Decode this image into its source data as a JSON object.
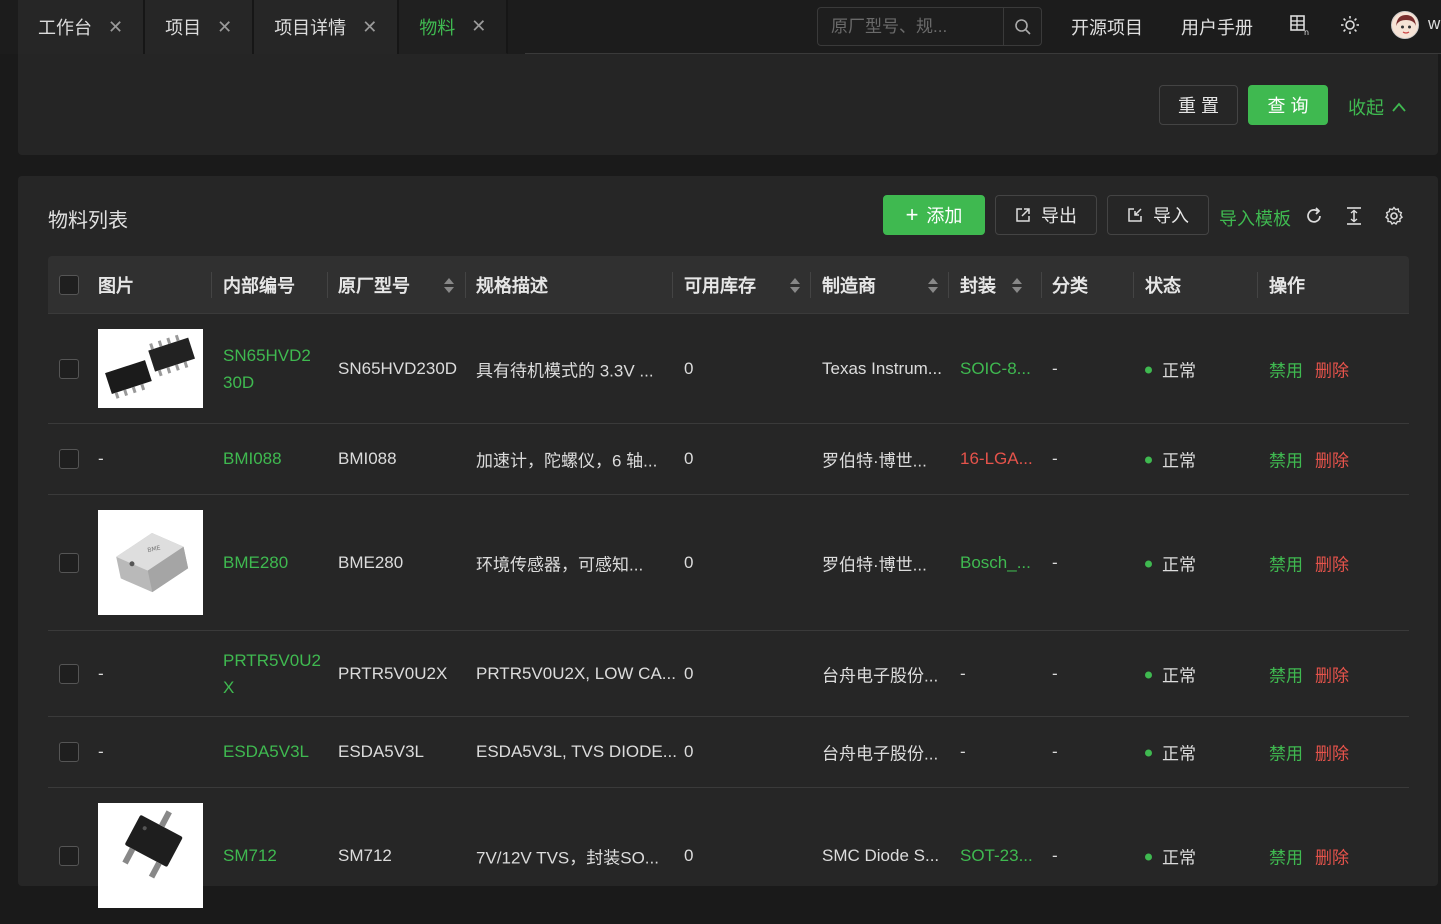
{
  "tabs": [
    {
      "label": "工作台",
      "close": "✕"
    },
    {
      "label": "项目",
      "close": "✕"
    },
    {
      "label": "项目详情",
      "close": "✕"
    },
    {
      "label": "物料",
      "close": "✕"
    }
  ],
  "header": {
    "search_placeholder": "原厂型号、规...",
    "links": [
      "开源项目",
      "用户手册"
    ],
    "user_name": "w"
  },
  "search_panel": {
    "reset_label": "重 置",
    "query_label": "查 询",
    "collapse_label": "收起"
  },
  "list": {
    "title": "物料列表",
    "add_label": "添加",
    "export_label": "导出",
    "import_label": "导入",
    "template_label": "导入模板"
  },
  "table": {
    "headers": [
      "图片",
      "内部编号",
      "原厂型号",
      "规格描述",
      "可用库存",
      "制造商",
      "封装",
      "分类",
      "状态",
      "操作"
    ],
    "rows": [
      {
        "image": "",
        "internal_id": "SN65HVD230D",
        "internal_id_l1": "SN65HVD2",
        "internal_id_l2": "30D",
        "model": "SN65HVD230D",
        "desc": "具有待机模式的 3.3V ...",
        "stock": "0",
        "maker": "Texas Instrum...",
        "package": "SOIC-8...",
        "category": "-",
        "status": "正常",
        "op_disable": "禁用",
        "op_delete": "删除"
      },
      {
        "image": "-",
        "internal_id_l1": "BMI088",
        "internal_id_l2": "",
        "model": "BMI088",
        "desc": "加速计，陀螺仪，6 轴...",
        "stock": "0",
        "maker": "罗伯特·博世...",
        "package": "16-LGA...",
        "category": "-",
        "status": "正常",
        "op_disable": "禁用",
        "op_delete": "删除"
      },
      {
        "image": "",
        "internal_id_l1": "BME280",
        "internal_id_l2": "",
        "model": "BME280",
        "desc": "环境传感器，可感知...",
        "stock": "0",
        "maker": "罗伯特·博世...",
        "package": "Bosch_...",
        "category": "-",
        "status": "正常",
        "op_disable": "禁用",
        "op_delete": "删除"
      },
      {
        "image": "-",
        "internal_id_l1": "PRTR5V0U2",
        "internal_id_l2": "X",
        "model": "PRTR5V0U2X",
        "desc": "PRTR5V0U2X, LOW CA...",
        "stock": "0",
        "maker": "台舟电子股份...",
        "package": "-",
        "category": "-",
        "status": "正常",
        "op_disable": "禁用",
        "op_delete": "删除"
      },
      {
        "image": "-",
        "internal_id_l1": "ESDA5V3L",
        "internal_id_l2": "",
        "model": "ESDA5V3L",
        "desc": "ESDA5V3L, TVS DIODE...",
        "stock": "0",
        "maker": "台舟电子股份...",
        "package": "-",
        "category": "-",
        "status": "正常",
        "op_disable": "禁用",
        "op_delete": "删除"
      },
      {
        "image": "",
        "internal_id_l1": "SM712",
        "internal_id_l2": "",
        "model": "SM712",
        "desc": "7V/12V TVS，封装SO...",
        "stock": "0",
        "maker": "SMC Diode S...",
        "package": "SOT-23...",
        "category": "-",
        "status": "正常",
        "op_disable": "禁用",
        "op_delete": "删除"
      }
    ]
  },
  "colors": {
    "accent": "#3fb950",
    "danger": "#e5534b",
    "package_red": "#e5534b"
  }
}
